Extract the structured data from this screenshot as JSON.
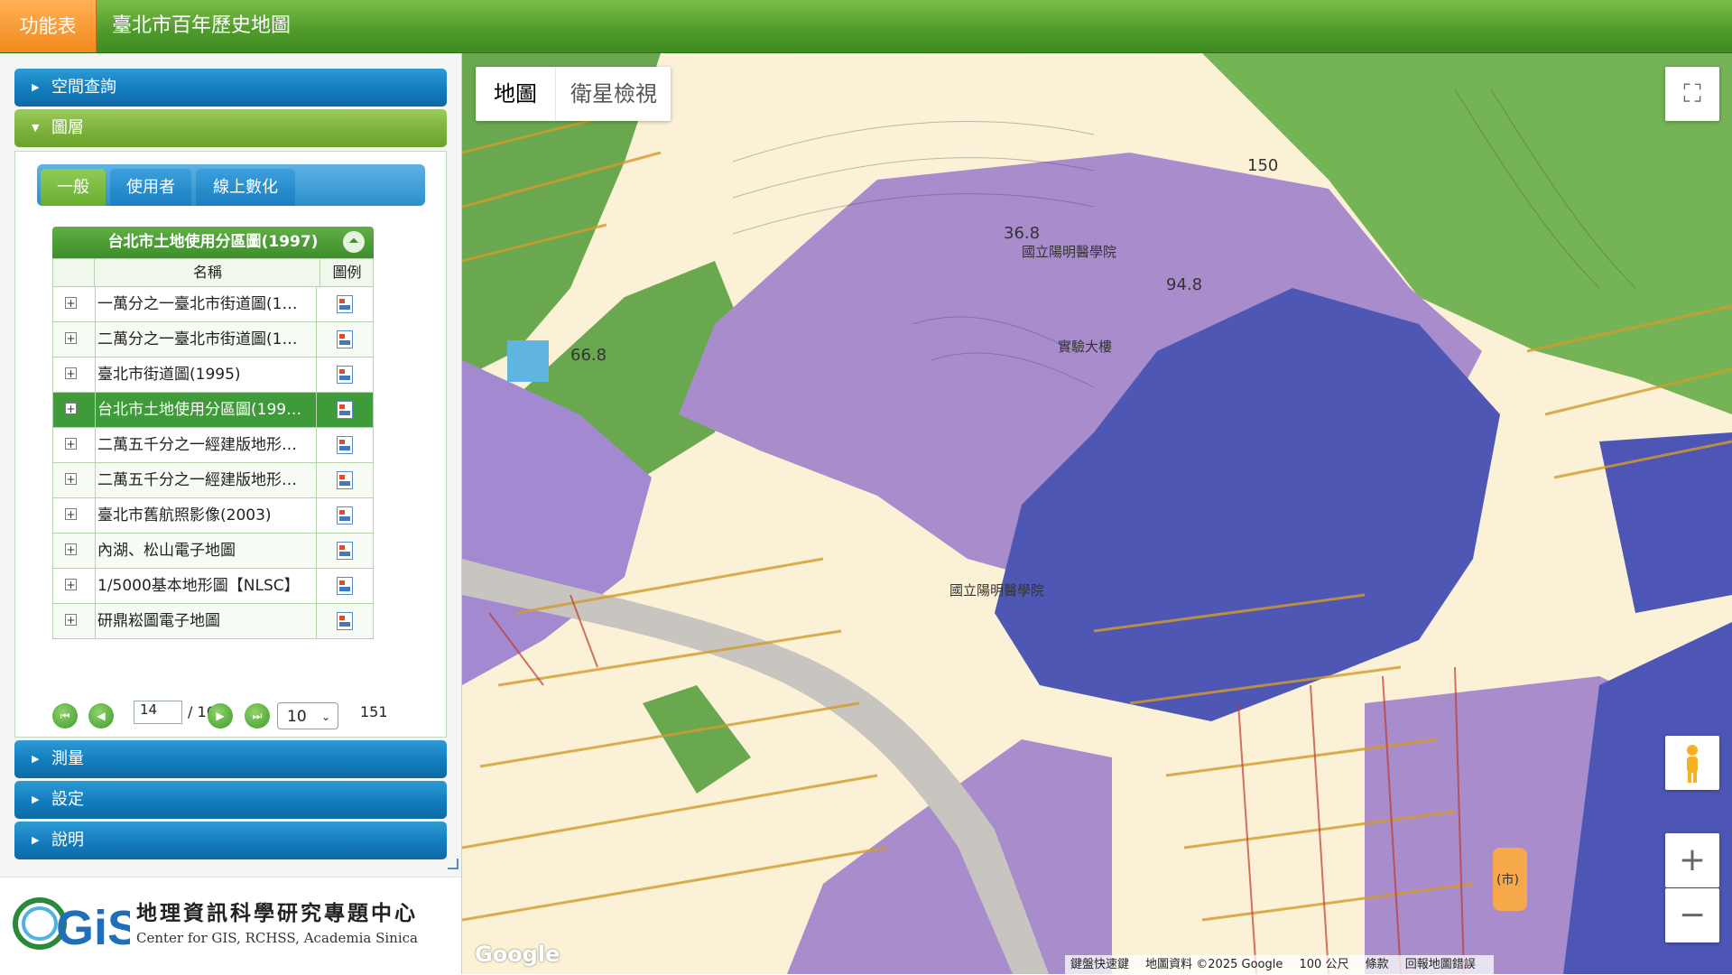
{
  "header": {
    "menu_label": "功能表",
    "title": "臺北市百年歷史地圖"
  },
  "sidebar": {
    "sections": {
      "spatial_query": "空間查詢",
      "layers": "圖層",
      "measure": "測量",
      "settings": "設定",
      "help": "說明"
    },
    "tabs": [
      "一般",
      "使用者",
      "線上數化"
    ],
    "grid": {
      "title": "台北市土地使用分區圖(1997)",
      "col_name": "名稱",
      "col_legend": "圖例",
      "rows": [
        {
          "name": "一萬分之一臺北市街道圖(1…",
          "selected": false
        },
        {
          "name": "二萬分之一臺北市街道圖(1…",
          "selected": false
        },
        {
          "name": "臺北市街道圖(1995)",
          "selected": false
        },
        {
          "name": "台北市土地使用分區圖(199…",
          "selected": true
        },
        {
          "name": "二萬五千分之一經建版地形…",
          "selected": false
        },
        {
          "name": "二萬五千分之一經建版地形…",
          "selected": false
        },
        {
          "name": "臺北市舊航照影像(2003)",
          "selected": false
        },
        {
          "name": "內湖、松山電子地圖",
          "selected": false
        },
        {
          "name": "1/5000基本地形圖【NLSC】",
          "selected": false
        },
        {
          "name": "研鼎崧圖電子地圖",
          "selected": false
        }
      ]
    },
    "pager": {
      "current_page": "14",
      "of_text": "/ 16",
      "page_size": "10",
      "total": "151"
    },
    "logo": {
      "cn": "地理資訊科學研究專題中心",
      "en": "Center for GIS, RCHSS, Academia Sinica",
      "mark": "GiS"
    }
  },
  "map": {
    "type_options": [
      "地圖",
      "衛星檢視"
    ],
    "attribution": {
      "shortcuts": "鍵盤快速鍵",
      "data": "地圖資料 ©2025 Google",
      "scale": "100 公尺",
      "terms": "條款",
      "report": "回報地圖錯誤"
    },
    "google_logo": "Google",
    "labels": {
      "school1": "國立陽明醫學院",
      "school2": "國立陽明醫學院",
      "building": "實驗大樓",
      "market": "(市)",
      "e1": "36.8",
      "e2": "94.8",
      "e3": "66.8",
      "e4": "150"
    }
  },
  "colors": {
    "accent_green": "#4f9a2a",
    "menu_orange": "#f28a1c",
    "accordion_blue": "#137dbd",
    "selected_row": "#3f9a3a"
  }
}
